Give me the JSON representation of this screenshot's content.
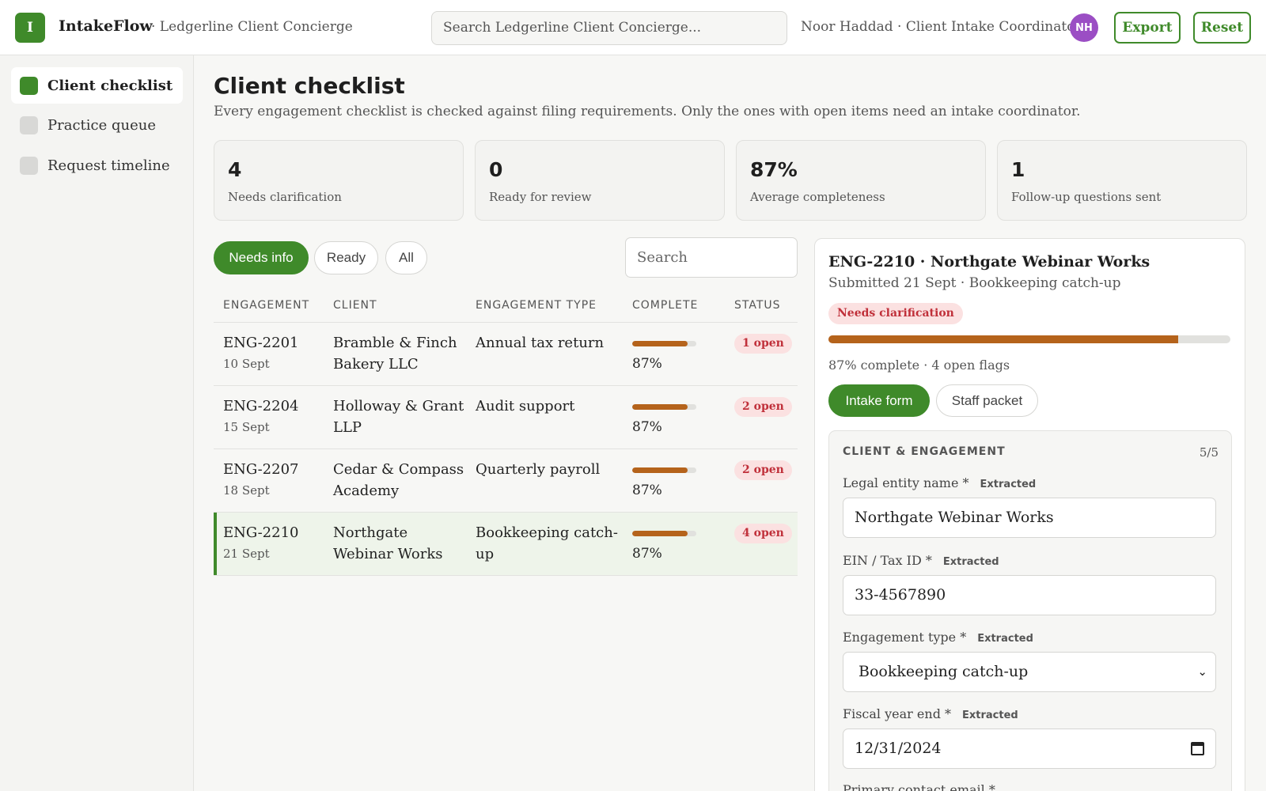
{
  "header": {
    "logo_letter": "I",
    "app_name": "IntakeFlow",
    "workspace": "· Ledgerline Client Concierge",
    "search_placeholder": "Search Ledgerline Client Concierge...",
    "user": "Noor Haddad · Client Intake Coordinator",
    "avatar_initials": "NH",
    "export_label": "Export",
    "reset_label": "Reset"
  },
  "sidebar": {
    "items": [
      {
        "label": "Client checklist",
        "active": true
      },
      {
        "label": "Practice queue",
        "active": false
      },
      {
        "label": "Request timeline",
        "active": false
      }
    ]
  },
  "main": {
    "title": "Client checklist",
    "description": "Every engagement checklist is checked against filing requirements. Only the ones with open items need an intake coordinator.",
    "stats": [
      {
        "value": "4",
        "label": "Needs clarification"
      },
      {
        "value": "0",
        "label": "Ready for review"
      },
      {
        "value": "87%",
        "label": "Average completeness"
      },
      {
        "value": "1",
        "label": "Follow-up questions sent"
      }
    ],
    "filters": [
      "Needs info",
      "Ready",
      "All"
    ],
    "active_filter": "Needs info",
    "search_placeholder": "Search",
    "columns": [
      "ENGAGEMENT",
      "CLIENT",
      "ENGAGEMENT TYPE",
      "COMPLETE",
      "STATUS"
    ],
    "rows": [
      {
        "id": "ENG-2201",
        "date": "10 Sept",
        "client_l1": "Bramble & Finch",
        "client_l2": "Bakery LLC",
        "type_l1": "Annual tax return",
        "type_l2": "",
        "complete": 0.87,
        "complete_label": "87%",
        "status": "1 open"
      },
      {
        "id": "ENG-2204",
        "date": "15 Sept",
        "client_l1": "Holloway & Grant",
        "client_l2": "LLP",
        "type_l1": "Audit support",
        "type_l2": "",
        "complete": 0.87,
        "complete_label": "87%",
        "status": "2 open"
      },
      {
        "id": "ENG-2207",
        "date": "18 Sept",
        "client_l1": "Cedar & Compass",
        "client_l2": "Academy",
        "type_l1": "Quarterly payroll",
        "type_l2": "",
        "complete": 0.87,
        "complete_label": "87%",
        "status": "2 open"
      },
      {
        "id": "ENG-2210",
        "date": "21 Sept",
        "client_l1": "Northgate",
        "client_l2": "Webinar Works",
        "type_l1": "Bookkeeping catch-",
        "type_l2": "up",
        "complete": 0.87,
        "complete_label": "87%",
        "status": "4 open"
      }
    ]
  },
  "detail": {
    "title": "ENG-2210 · Northgate Webinar Works",
    "subtitle": "Submitted 21 Sept · Bookkeeping catch-up",
    "badge": "Needs clarification",
    "progress": 0.87,
    "meta": "87% complete · 4 open flags",
    "tabs": [
      "Intake form",
      "Staff packet"
    ],
    "section": {
      "title": "CLIENT & ENGAGEMENT",
      "count": "5/5",
      "fields": [
        {
          "label": "Legal entity name *",
          "tag": "Extracted",
          "value": "Northgate Webinar Works"
        },
        {
          "label": "EIN / Tax ID *",
          "tag": "Extracted",
          "value": "33-4567890"
        },
        {
          "label": "Engagement type *",
          "tag": "Extracted",
          "value": "Bookkeeping catch-up"
        },
        {
          "label": "Fiscal year end *",
          "tag": "Extracted",
          "value": "12/31/2024"
        },
        {
          "label": "Primary contact email *",
          "tag": "",
          "value": ""
        }
      ]
    }
  },
  "colors": {
    "accent": "#3f8a2a",
    "progress": "#b5631b",
    "danger_bg": "#fbe1e1",
    "danger_text": "#c0303a",
    "avatar": "#9b4ec4"
  }
}
